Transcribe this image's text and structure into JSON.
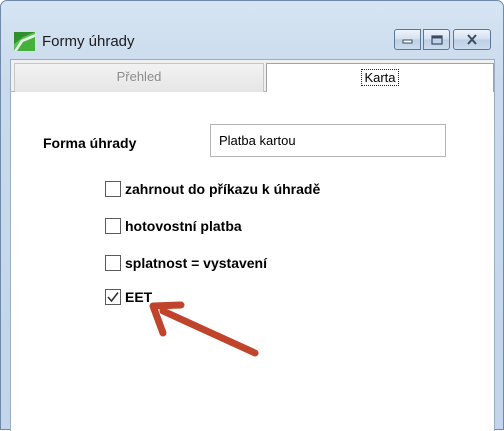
{
  "window": {
    "title": "Formy úhrady"
  },
  "titlebar_buttons": {
    "minimize": "minimize-icon",
    "maximize": "maximize-icon",
    "close": "close-icon"
  },
  "tabs": [
    {
      "label": "Přehled",
      "active": false
    },
    {
      "label": "Karta",
      "active": true
    }
  ],
  "form": {
    "field_label": "Forma úhrady",
    "field_value": "Platba kartou"
  },
  "checkboxes": [
    {
      "label": "zahrnout do příkazu k úhradě",
      "checked": false
    },
    {
      "label": "hotovostní platba",
      "checked": false
    },
    {
      "label": "splatnost = vystavení",
      "checked": false
    },
    {
      "label": "EET",
      "checked": true
    }
  ],
  "colors": {
    "arrow": "#c0432c",
    "app_icon": "#3aa935"
  }
}
